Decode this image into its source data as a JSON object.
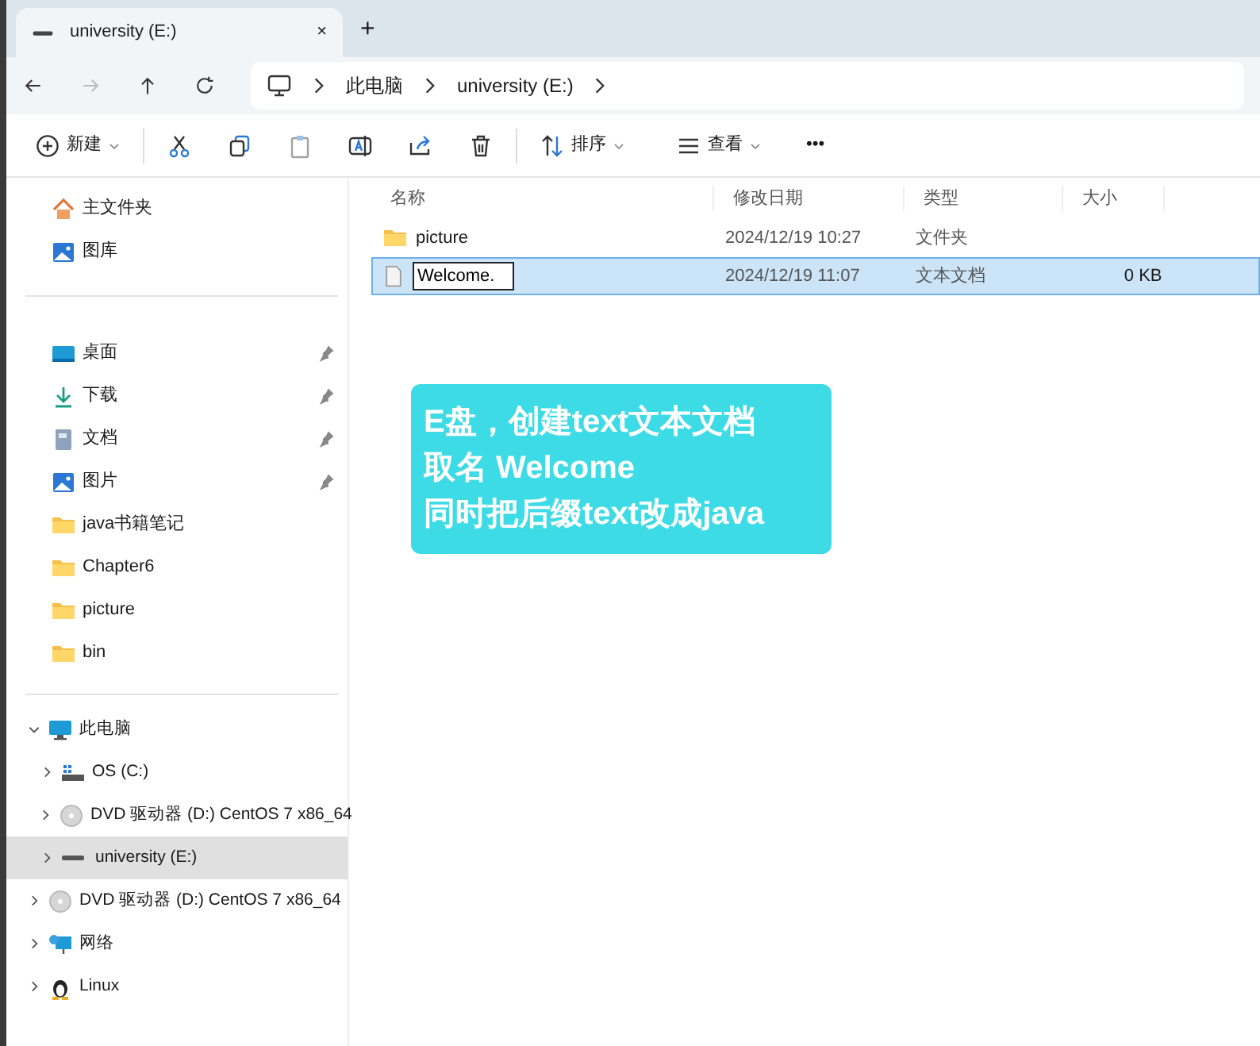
{
  "tab": {
    "title": "university (E:)",
    "close": "×",
    "new_tab": "+"
  },
  "breadcrumb": [
    "此电脑",
    "university (E:)"
  ],
  "toolbar": [
    {
      "kind": "new",
      "label": "新建",
      "disabled": false
    },
    {
      "kind": "cut",
      "disabled": false
    },
    {
      "kind": "copy",
      "disabled": false
    },
    {
      "kind": "paste",
      "disabled": true
    },
    {
      "kind": "rename",
      "disabled": false
    },
    {
      "kind": "share",
      "disabled": false
    },
    {
      "kind": "delete",
      "disabled": false
    },
    {
      "kind": "sort",
      "label": "排序",
      "disabled": false
    },
    {
      "kind": "view",
      "label": "查看",
      "disabled": false
    },
    {
      "kind": "more",
      "label": "•••",
      "disabled": false
    }
  ],
  "sidebar": {
    "top": [
      {
        "kind": "home",
        "label": "主文件夹"
      },
      {
        "kind": "gallery",
        "label": "图库"
      }
    ],
    "quick": [
      {
        "kind": "desktop",
        "label": "桌面",
        "pinned": true
      },
      {
        "kind": "download",
        "label": "下载",
        "pinned": true
      },
      {
        "kind": "document",
        "label": "文档",
        "pinned": true
      },
      {
        "kind": "gallery",
        "label": "图片",
        "pinned": true
      },
      {
        "kind": "folder",
        "label": "java书籍笔记",
        "pinned": false
      },
      {
        "kind": "folder",
        "label": "Chapter6",
        "pinned": false
      },
      {
        "kind": "folder",
        "label": "picture",
        "pinned": false
      },
      {
        "kind": "folder",
        "label": "bin",
        "pinned": false
      }
    ],
    "tree": [
      {
        "kind": "pc",
        "label": "此电脑",
        "expanded": true,
        "selected": false,
        "children": [
          {
            "kind": "os",
            "label": "OS (C:)",
            "expanded": false,
            "selected": false
          },
          {
            "kind": "dvd",
            "label": "DVD 驱动器 (D:) CentOS 7 x86_64",
            "expanded": false,
            "selected": false
          },
          {
            "kind": "drive",
            "label": "university (E:)",
            "expanded": false,
            "selected": true
          }
        ]
      },
      {
        "kind": "dvd",
        "label": "DVD 驱动器 (D:) CentOS 7 x86_64",
        "expanded": false,
        "selected": false
      },
      {
        "kind": "network",
        "label": "网络",
        "expanded": false,
        "selected": false
      },
      {
        "kind": "linux",
        "label": "Linux",
        "expanded": false,
        "selected": false
      }
    ]
  },
  "files": {
    "columns": [
      "名称",
      "修改日期",
      "类型",
      "大小"
    ],
    "rows": [
      {
        "kind": "folder",
        "name": "picture",
        "date": "2024/12/19 10:27",
        "type": "文件夹",
        "selected": false,
        "renaming": false
      },
      {
        "kind": "file",
        "name": "Welcome.",
        "date": "2024/12/19 11:07",
        "type": "文本文档",
        "size": "0 KB",
        "selected": true,
        "renaming": true
      }
    ]
  },
  "callout": [
    "E盘，创建text文本文档",
    "取名 Welcome",
    "同时把后缀text改成java"
  ]
}
